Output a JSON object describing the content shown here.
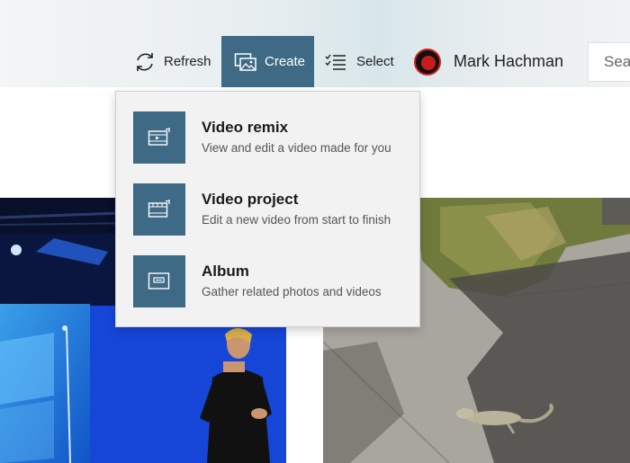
{
  "toolbar": {
    "refresh_label": "Refresh",
    "create_label": "Create",
    "select_label": "Select",
    "user_name": "Mark Hachman",
    "search_placeholder": "Sea",
    "accent_color": "#3f6a85"
  },
  "create_menu": {
    "items": [
      {
        "title": "Video remix",
        "description": "View and edit a video made for you",
        "icon": "video-remix-icon"
      },
      {
        "title": "Video project",
        "description": "Edit a new video from start to finish",
        "icon": "video-project-icon"
      },
      {
        "title": "Album",
        "description": "Gather related photos and videos",
        "icon": "album-icon"
      }
    ]
  },
  "gallery": {
    "photos": [
      {
        "subject": "presenter on stage with blue Windows screen"
      },
      {
        "subject": "lizard on sidewalk next to grass"
      }
    ]
  }
}
